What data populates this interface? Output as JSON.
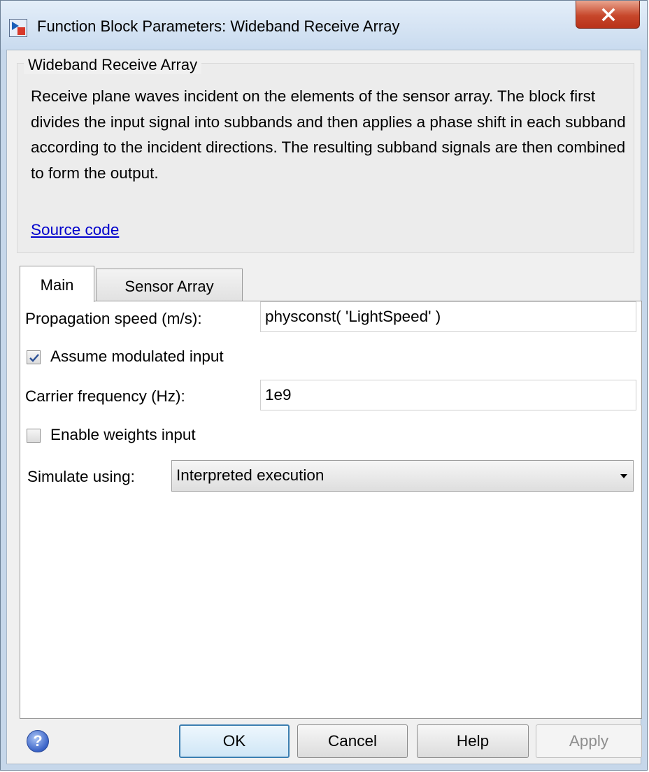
{
  "window": {
    "title": "Function Block Parameters: Wideband Receive Array",
    "app_icon": "simulink-block-icon",
    "close_icon": "close-x-icon"
  },
  "group": {
    "title": "Wideband Receive Array",
    "description": "Receive plane waves incident on the elements of the sensor array. The block first divides the input signal into subbands and then applies a phase shift in each subband according to the incident directions. The resulting subband signals are then combined to form the output.",
    "source_link": "Source code"
  },
  "tabs": [
    {
      "label": "Main",
      "active": true
    },
    {
      "label": "Sensor Array",
      "active": false
    }
  ],
  "main": {
    "propagation_label": "Propagation speed (m/s):",
    "propagation_value": "physconst( 'LightSpeed' )",
    "assume_modulated_label": "Assume modulated input",
    "assume_modulated_checked": true,
    "carrier_label": "Carrier frequency (Hz):",
    "carrier_value": "1e9",
    "enable_weights_label": "Enable weights input",
    "enable_weights_checked": false,
    "simulate_label": "Simulate using:",
    "simulate_value": "Interpreted execution"
  },
  "buttons": {
    "help_icon": "?",
    "ok": "OK",
    "cancel": "Cancel",
    "help": "Help",
    "apply": "Apply"
  },
  "colors": {
    "link": "#0000cc",
    "ok_border": "#3c7fb1",
    "close_button": "#c7472b",
    "disabled_text": "#8d8d8d"
  }
}
